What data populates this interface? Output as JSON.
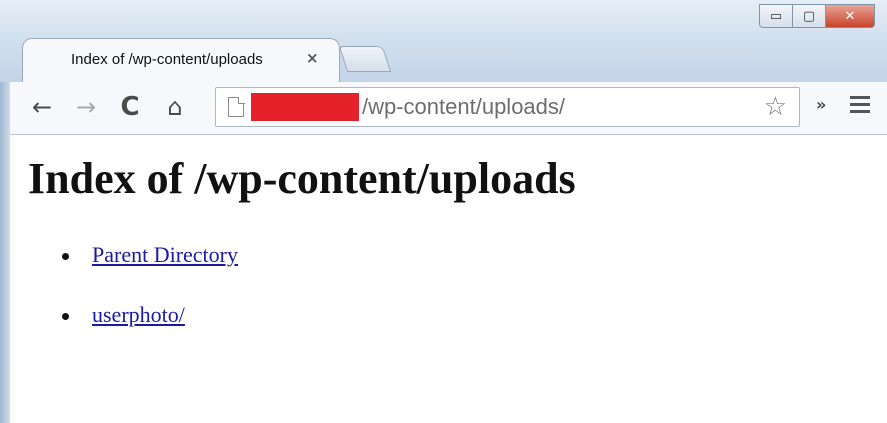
{
  "window": {
    "controls": {
      "minimize": "▭",
      "maximize": "▢",
      "close": "✕"
    }
  },
  "tab": {
    "title": "Index of /wp-content/uploads",
    "close_glyph": "×"
  },
  "toolbar": {
    "back_glyph": "←",
    "forward_glyph": "→",
    "reload_glyph": "C",
    "home_glyph": "⌂",
    "url_path": "/wp-content/uploads/",
    "star_glyph": "☆",
    "extensions_glyph": "»",
    "icons": [
      "back-arrow-icon",
      "forward-arrow-icon",
      "reload-icon",
      "home-icon",
      "page-icon",
      "star-icon",
      "chevron-icon",
      "menu-icon"
    ],
    "redaction_color": "#e5222a"
  },
  "page": {
    "heading": "Index of /wp-content/uploads",
    "links": [
      {
        "label": "Parent Directory"
      },
      {
        "label": "userphoto/"
      }
    ],
    "link_color": "#1a1aa6"
  }
}
